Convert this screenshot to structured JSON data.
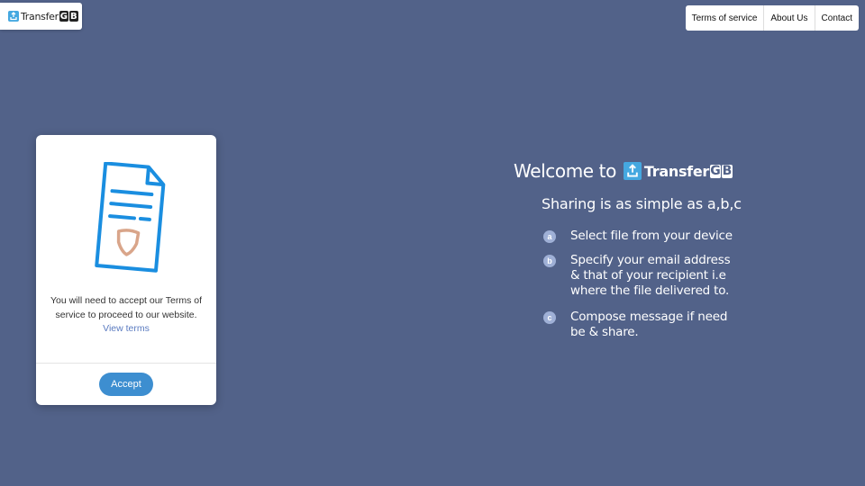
{
  "brand": {
    "name": "Transfer",
    "suffix": [
      "G",
      "B"
    ],
    "icon": "upload-icon"
  },
  "nav": {
    "items": [
      {
        "label": "Terms of service"
      },
      {
        "label": "About Us"
      },
      {
        "label": "Contact"
      }
    ]
  },
  "card": {
    "icon": "document-shield-icon",
    "message": "You will need to accept our Terms of service to proceed to our website.",
    "link_label": "View terms",
    "accept_label": "Accept"
  },
  "welcome": {
    "prefix": "Welcome to",
    "tagline": "Sharing is as simple as a,b,c",
    "steps": [
      {
        "badge": "a",
        "text": "Select file from your device"
      },
      {
        "badge": "b",
        "text": "Specify your email address\n&  that of your recipient i.e\nwhere the file delivered to."
      },
      {
        "badge": "c",
        "text": "Compose message if need\nbe & share."
      }
    ]
  },
  "colors": {
    "background": "#526289",
    "accent": "#3d8ed0",
    "brand_icon": "#45a8e0",
    "document_stroke": "#1a8ee0",
    "shield": "#d9a58a"
  }
}
